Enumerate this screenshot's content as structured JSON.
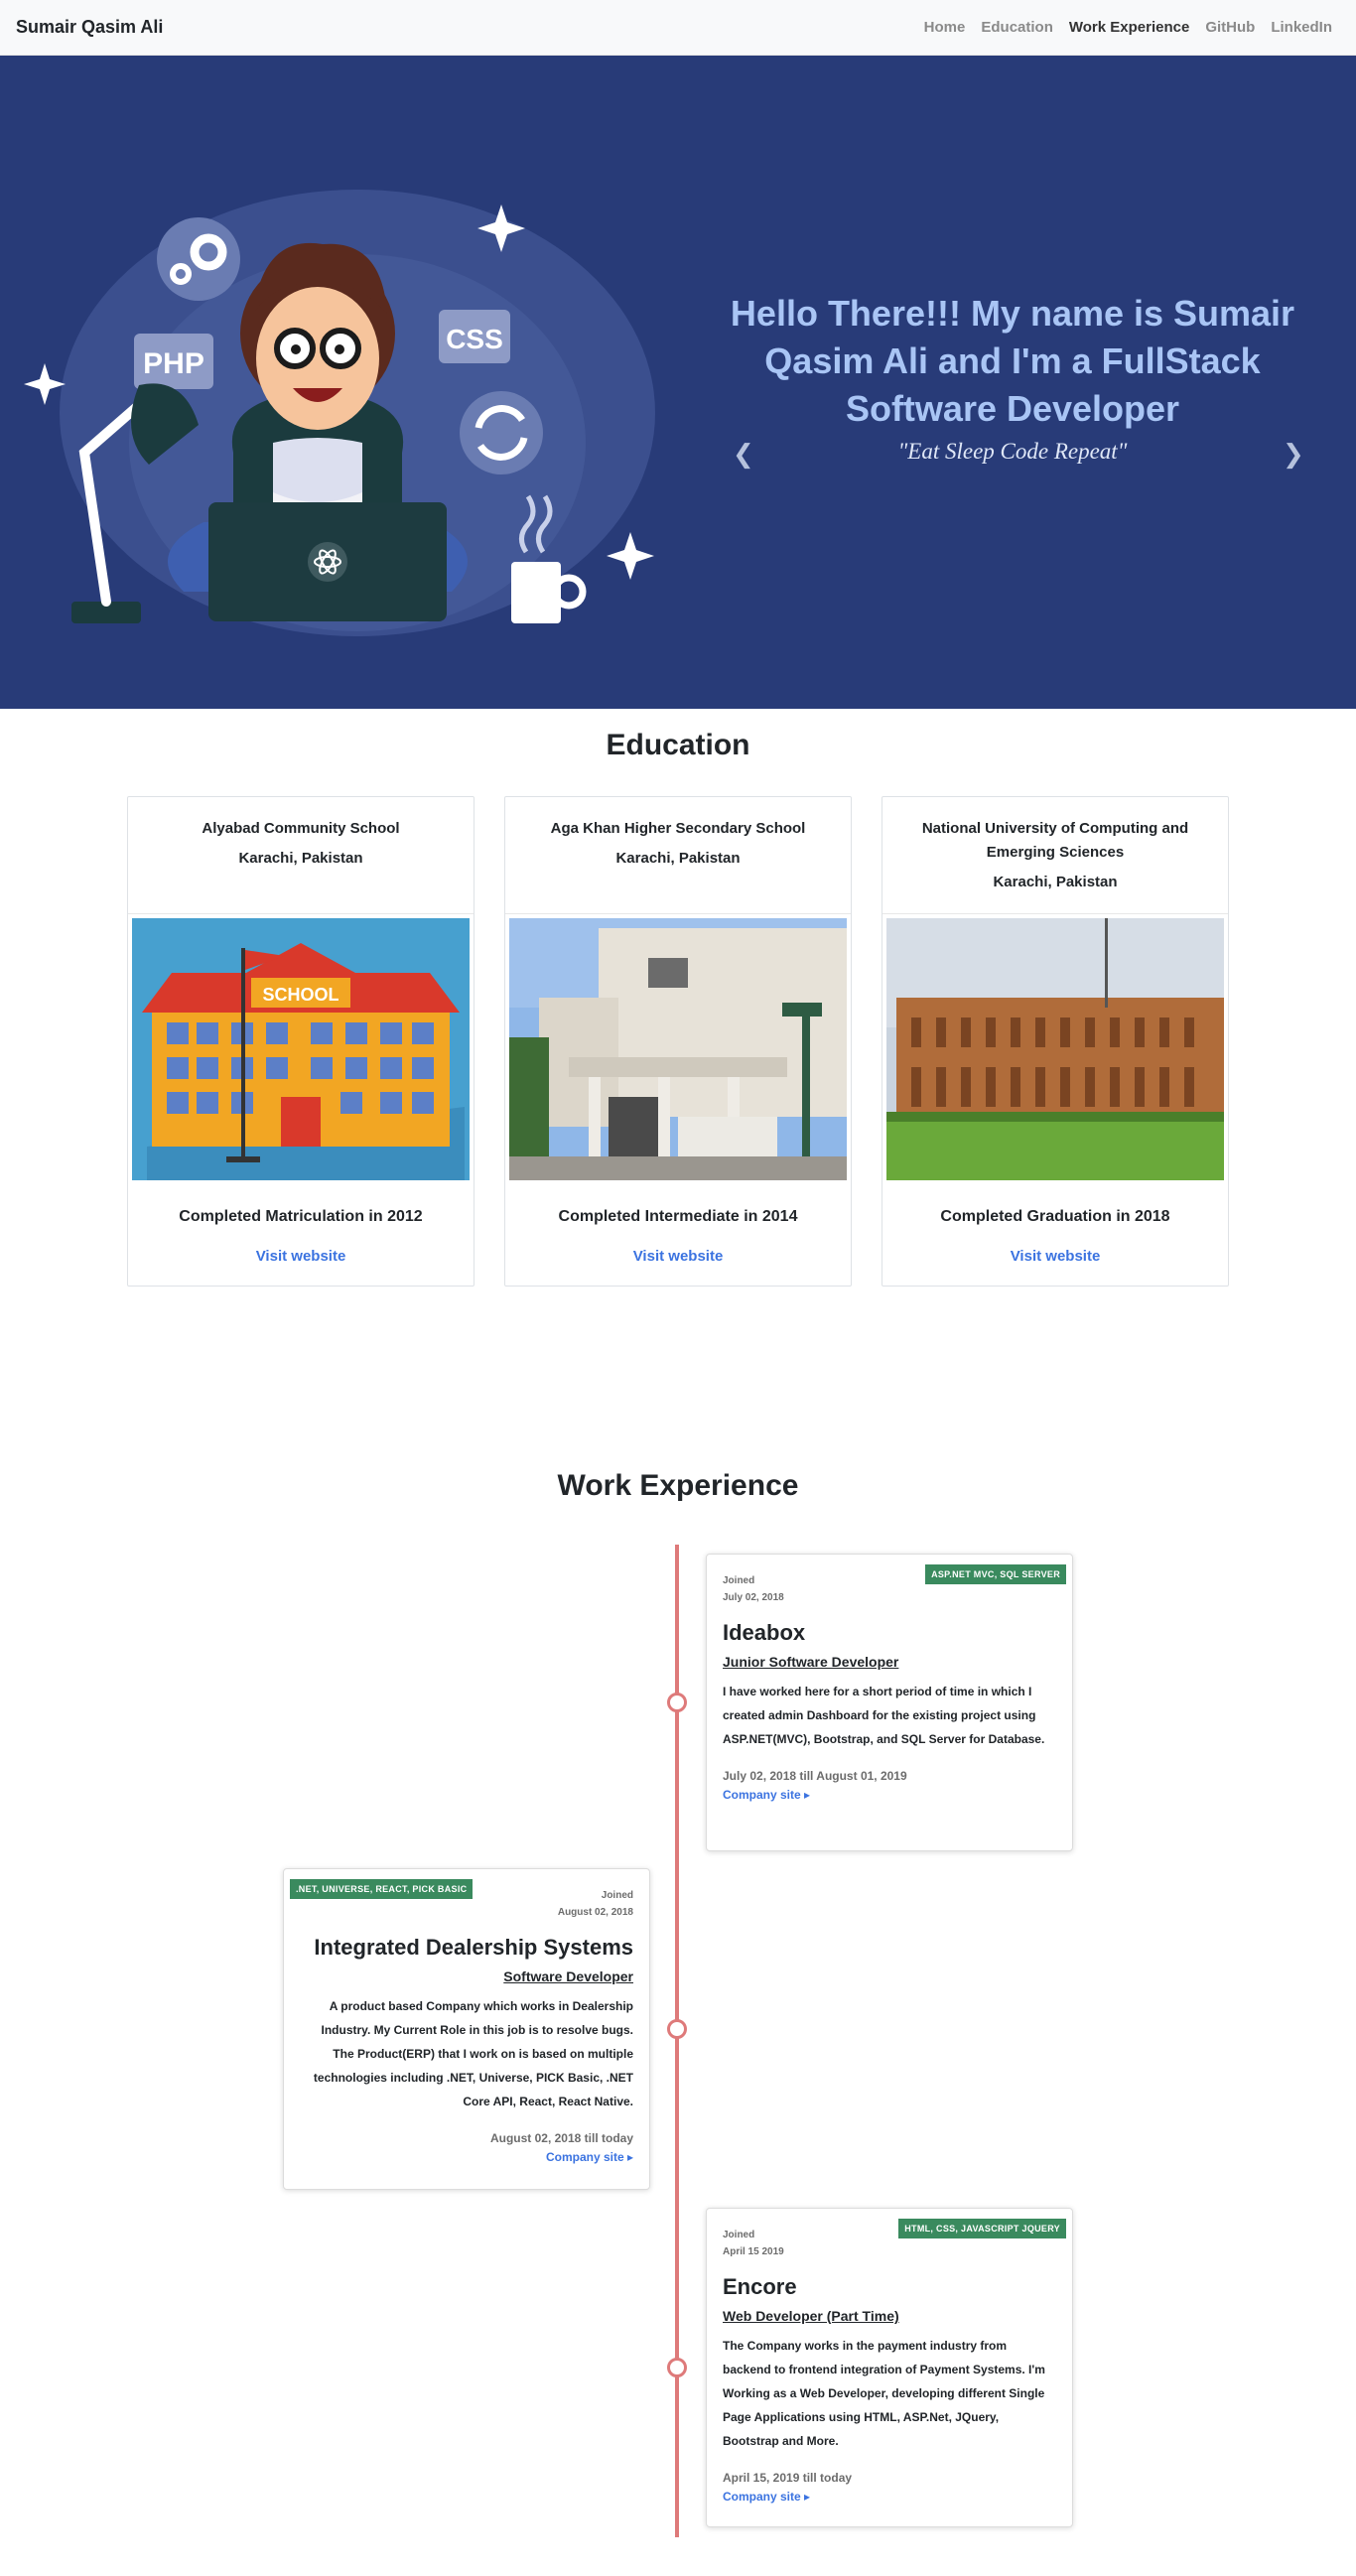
{
  "nav": {
    "brand": "Sumair Qasim Ali",
    "links": [
      "Home",
      "Education",
      "Work Experience",
      "GitHub",
      "LinkedIn"
    ]
  },
  "hero": {
    "title": "Hello There!!! My name is Sumair Qasim Ali and I'm a FullStack Software Developer",
    "quote": "\"Eat Sleep Code Repeat\"",
    "art_labels": {
      "php": "PHP",
      "css": "CSS"
    },
    "prev_icon": "chevron-left-icon",
    "next_icon": "chevron-right-icon"
  },
  "education": {
    "title": "Education",
    "cards": [
      {
        "school": "Alyabad Community School",
        "location": "Karachi, Pakistan",
        "status": "Completed Matriculation in 2012",
        "link": "Visit website",
        "sign": "SCHOOL"
      },
      {
        "school": "Aga Khan Higher Secondary School",
        "location": "Karachi, Pakistan",
        "status": "Completed Intermediate in 2014",
        "link": "Visit website"
      },
      {
        "school": "National University of Computing and Emerging Sciences",
        "location": "Karachi, Pakistan",
        "status": "Completed Graduation in 2018",
        "link": "Visit website"
      }
    ]
  },
  "work": {
    "title": "Work Experience",
    "jobs": [
      {
        "tag": "ASP.NET MVC, SQL SERVER",
        "joined_label": "Joined",
        "joined_date": "July 02, 2018",
        "company": "Ideabox",
        "role": "Junior Software Developer",
        "description": "I have worked here for a short period of time in which I created admin Dashboard for the existing project using ASP.NET(MVC), Bootstrap, and SQL Server for Database.",
        "period": "July 02, 2018 till August 01, 2019",
        "link": "Company site ▸"
      },
      {
        "tag": ".NET, UNIVERSE, REACT, PICK BASIC",
        "joined_label": "Joined",
        "joined_date": "August 02, 2018",
        "company": "Integrated Dealership Systems",
        "role": "Software Developer",
        "description": "A product based Company which works in Dealership Industry. My Current Role in this job is to resolve bugs. The Product(ERP) that I work on is based on multiple technologies including .NET, Universe, PICK Basic, .NET Core API, React, React Native.",
        "period": "August 02, 2018 till today",
        "link": "Company site ▸"
      },
      {
        "tag": "HTML, CSS, JAVASCRIPT JQUERY",
        "joined_label": "Joined",
        "joined_date": "April 15 2019",
        "company": "Encore",
        "role": "Web Developer (Part Time)",
        "description": "The Company works in the payment industry from backend to frontend integration of Payment Systems. I'm Working as a Web Developer, developing different Single Page Applications using HTML, ASP.Net, JQuery, Bootstrap and More.",
        "period": "April 15, 2019 till today",
        "link": "Company site ▸"
      }
    ]
  }
}
